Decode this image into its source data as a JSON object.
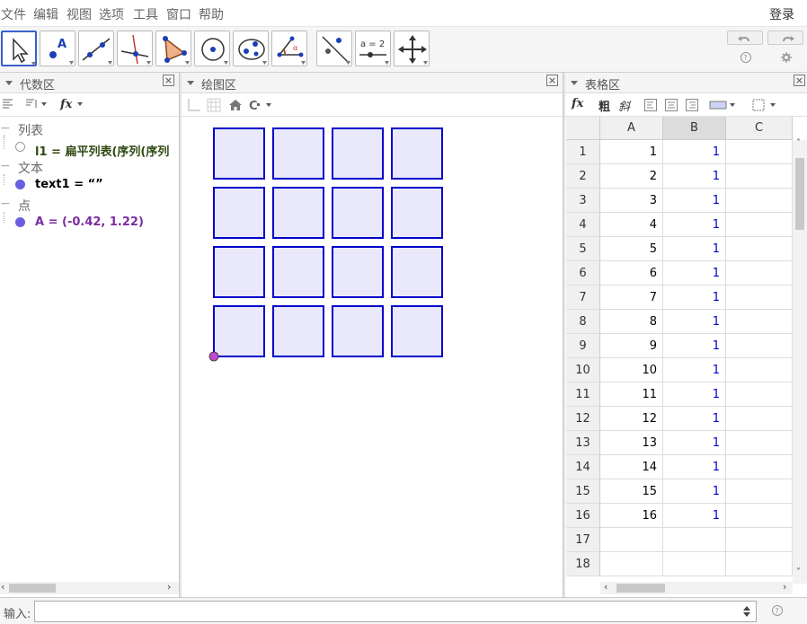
{
  "menu": [
    "文件",
    "编辑",
    "视图",
    "选项",
    "工具",
    "窗口",
    "帮助"
  ],
  "login": "登录",
  "toolbar": {
    "tools": [
      "move-tool",
      "point-tool",
      "line-tool",
      "perpendicular-tool",
      "polygon-tool",
      "circle-tool",
      "conic-tool",
      "angle-tool",
      "reflect-tool",
      "slider-tool",
      "move-view-tool"
    ],
    "slider_label": "a = 2",
    "help_icon": "?",
    "settings_icon": "gear"
  },
  "algebra": {
    "title": "代数区",
    "groups": [
      {
        "label": "列表",
        "items": [
          {
            "text": "l1 = 扁平列表(序列(序列",
            "color": "#2e4a12",
            "filled": false
          }
        ]
      },
      {
        "label": "文本",
        "items": [
          {
            "text": "text1 = “”",
            "color": "#000000",
            "filled": true
          }
        ]
      },
      {
        "label": "点",
        "items": [
          {
            "text": "A = (-0.42, 1.22)",
            "color": "#7a2da0",
            "filled": true
          }
        ]
      }
    ]
  },
  "graphics": {
    "title": "绘图区",
    "grid_rows": 4,
    "grid_cols": 4,
    "square_fill": "#e9e9fb",
    "square_stroke": "#0000cc",
    "point_color": "#c04bc8"
  },
  "spreadsheet": {
    "title": "表格区",
    "toolbar": {
      "fx": "fx",
      "bold": "粗",
      "italic": "斜"
    },
    "columns": [
      "A",
      "B",
      "C"
    ],
    "rows": [
      {
        "n": "1",
        "a": "1",
        "b": "1"
      },
      {
        "n": "2",
        "a": "2",
        "b": "1"
      },
      {
        "n": "3",
        "a": "3",
        "b": "1"
      },
      {
        "n": "4",
        "a": "4",
        "b": "1"
      },
      {
        "n": "5",
        "a": "5",
        "b": "1"
      },
      {
        "n": "6",
        "a": "6",
        "b": "1"
      },
      {
        "n": "7",
        "a": "7",
        "b": "1"
      },
      {
        "n": "8",
        "a": "8",
        "b": "1"
      },
      {
        "n": "9",
        "a": "9",
        "b": "1"
      },
      {
        "n": "10",
        "a": "10",
        "b": "1"
      },
      {
        "n": "11",
        "a": "11",
        "b": "1"
      },
      {
        "n": "12",
        "a": "12",
        "b": "1"
      },
      {
        "n": "13",
        "a": "13",
        "b": "1"
      },
      {
        "n": "14",
        "a": "14",
        "b": "1"
      },
      {
        "n": "15",
        "a": "15",
        "b": "1"
      },
      {
        "n": "16",
        "a": "16",
        "b": "1"
      },
      {
        "n": "17",
        "a": "",
        "b": ""
      },
      {
        "n": "18",
        "a": "",
        "b": ""
      }
    ],
    "b_color": "#0000cc"
  },
  "input": {
    "label": "输入:",
    "value": ""
  }
}
